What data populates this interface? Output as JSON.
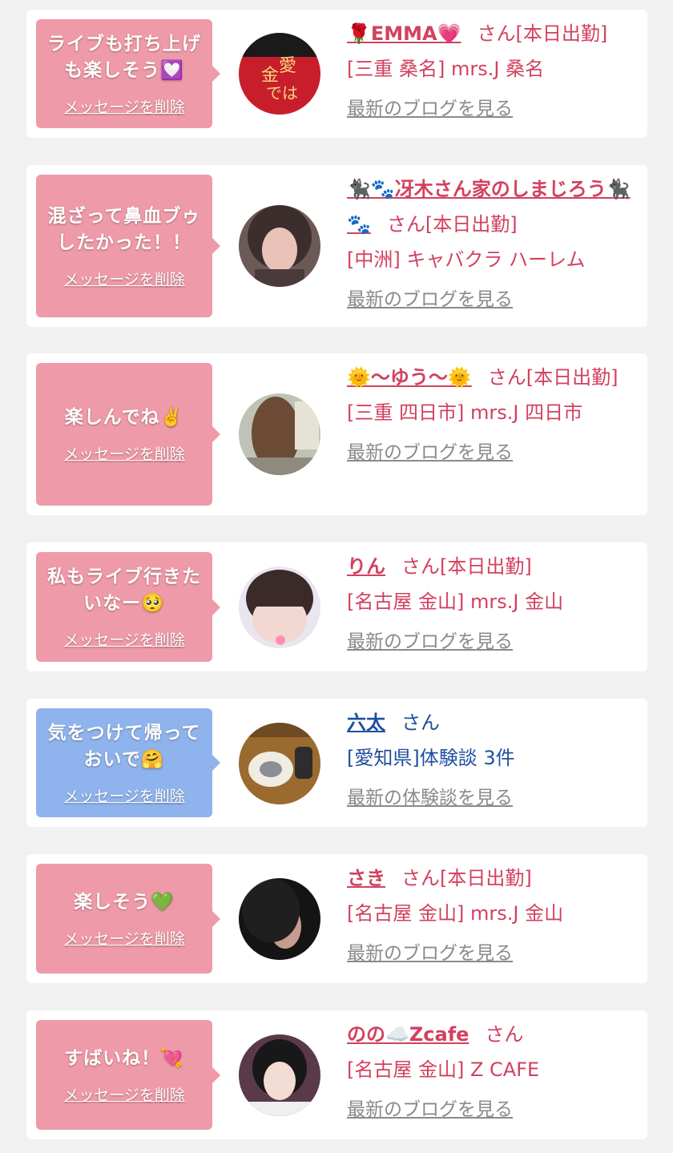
{
  "colors": {
    "bubble_pink": "#ef9aa8",
    "bubble_blue": "#8fb3ec",
    "text_pink": "#d2415f",
    "text_blue": "#1f4f9f",
    "link_gray": "#8a8a8a"
  },
  "delete_label": "メッセージを削除",
  "items": [
    {
      "message": "ライブも打ち上げも楽しそう💟",
      "name": "🌹EMMA💗",
      "suffix": "さん[本日出勤]",
      "shop": "[三重 桑名] mrs.J 桑名",
      "blog": "最新のブログを見る"
    },
    {
      "message": "混ざって鼻血ブゥしたかった！！",
      "name": "🐈‍⬛🐾冴木さん家のしまじろう🐈‍⬛🐾",
      "suffix": "さん[本日出勤]",
      "shop": "[中洲] キャバクラ ハーレム",
      "blog": "最新のブログを見る"
    },
    {
      "message": "楽しんでね✌️",
      "name": "🌞〜ゆう〜🌞",
      "suffix": "さん[本日出勤]",
      "shop": "[三重 四日市] mrs.J 四日市",
      "blog": "最新のブログを見る"
    },
    {
      "message": "私もライブ行きたいなー🥺",
      "name": "りん",
      "suffix": "さん[本日出勤]",
      "shop": "[名古屋 金山] mrs.J 金山",
      "blog": "最新のブログを見る"
    },
    {
      "message": "気をつけて帰っておいで🤗",
      "name": "六太",
      "suffix": "さん",
      "shop": "[愛知県]体験談 3件",
      "blog": "最新の体験談を見る"
    },
    {
      "message": "楽しそう💚",
      "name": "さき",
      "suffix": "さん[本日出勤]",
      "shop": "[名古屋 金山] mrs.J 金山",
      "blog": "最新のブログを見る"
    },
    {
      "message": "すばいね！💘",
      "name": "のの☁️Zcafe",
      "suffix": "さん",
      "shop": "[名古屋 金山] Z CAFE",
      "blog": "最新のブログを見る"
    }
  ]
}
